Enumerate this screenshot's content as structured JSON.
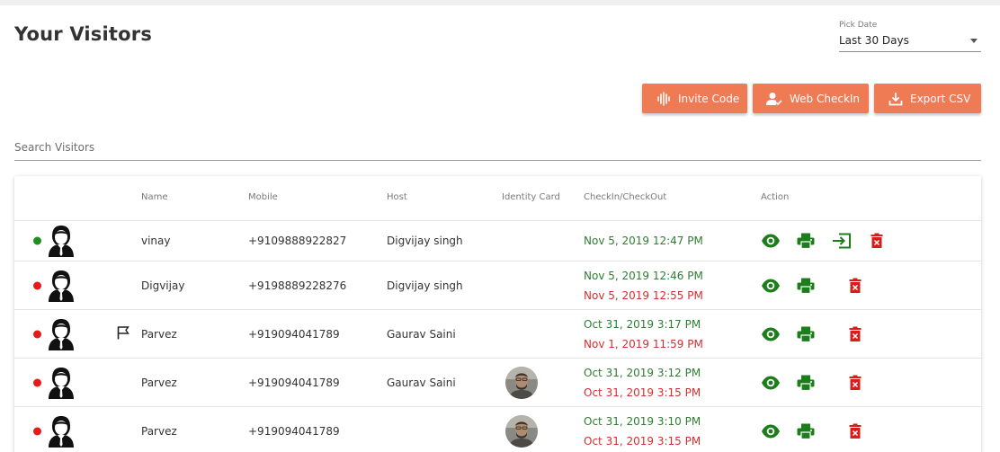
{
  "header": {
    "title": "Your Visitors",
    "pick_date": {
      "label": "Pick Date",
      "value": "Last 30 Days"
    }
  },
  "buttons": {
    "invite": "Invite Code",
    "web_checkin": "Web CheckIn",
    "export": "Export CSV"
  },
  "search": {
    "placeholder": "Search Visitors"
  },
  "table": {
    "columns": [
      "Name",
      "Mobile",
      "Host",
      "Identity Card",
      "CheckIn/CheckOut",
      "Action"
    ],
    "rows": [
      {
        "status": "green",
        "name": "vinay",
        "mobile": "+9109888922827",
        "host": "Digvijay singh",
        "checkin": "Nov 5, 2019 12:47 PM",
        "checkout": ""
      },
      {
        "status": "red",
        "name": "Digvijay",
        "mobile": "+9198889228276",
        "host": "Digvijay singh",
        "checkin": "Nov 5, 2019 12:46 PM",
        "checkout": "Nov 5, 2019 12:55 PM"
      },
      {
        "status": "red",
        "name": "Parvez",
        "mobile": "+919094041789",
        "host": "Gaurav Saini",
        "checkin": "Oct 31, 2019 3:17 PM",
        "checkout": "Nov 1, 2019 11:59 PM"
      },
      {
        "status": "red",
        "name": "Parvez",
        "mobile": "+919094041789",
        "host": "Gaurav Saini",
        "checkin": "Oct 31, 2019 3:12 PM",
        "checkout": "Oct 31, 2019 3:15 PM"
      },
      {
        "status": "red",
        "name": "Parvez",
        "mobile": "+919094041789",
        "host": "",
        "checkin": "Oct 31, 2019 3:10 PM",
        "checkout": "Oct 31, 2019 3:15 PM"
      }
    ]
  },
  "colors": {
    "accent": "#ef7b55",
    "checkin": "#2e7d32",
    "checkout": "#d32f2f",
    "status_active": "#1e8e1e",
    "status_inactive": "#e31b1b",
    "delete": "#d81b1b"
  },
  "icons": [
    "audio-wave-icon",
    "user-check-icon",
    "download-icon",
    "eye-icon",
    "printer-icon",
    "sign-in-icon",
    "delete-icon",
    "flag-icon",
    "avatar-icon",
    "identity-card-photo"
  ]
}
